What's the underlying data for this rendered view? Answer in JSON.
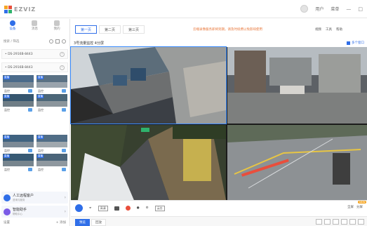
{
  "app": {
    "logo_text": "EZVIZ",
    "user_name": "用户",
    "menu_label": "菜单"
  },
  "window_controls": [
    "—",
    "□"
  ],
  "nav_tabs": [
    {
      "label": "设备",
      "icon": "camera-icon"
    },
    {
      "label": "消息",
      "icon": "bell-icon"
    },
    {
      "label": "我的",
      "icon": "grid-icon"
    }
  ],
  "search": {
    "placeholder": "搜索 / 筛选"
  },
  "device_rows": [
    "• DS-2916B-8443",
    "• DS-2916B-8443"
  ],
  "thumb_tag": "直播",
  "thumb_label": "监控",
  "assistant_cards": [
    {
      "title": "人工远程客户",
      "sub": "咨询与服务"
    },
    {
      "title": "智能助手",
      "sub": "帮助中心"
    }
  ],
  "bottom_left": {
    "left": "设置",
    "right": "+ 添加"
  },
  "view_tabs": [
    "第一页",
    "第二页",
    "第三页"
  ],
  "notice": "云端录像服务即将到期，请及时续费以免影响使用",
  "top_tools": [
    "视频",
    "工具",
    "帮助"
  ],
  "view_title": "3号流量监控 4分屏",
  "view_right": "多个窗口",
  "playbar": {
    "quality": "高清",
    "ptz": "云台",
    "right_a": "全屏",
    "right_b": "分屏",
    "badge": "NEW"
  },
  "bottom_tabs": [
    "预览",
    "回放"
  ]
}
